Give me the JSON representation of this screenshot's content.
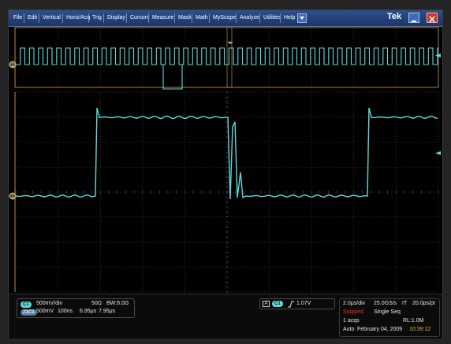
{
  "menu": {
    "items": [
      "File",
      "Edit",
      "Vertical",
      "Horiz/Acq",
      "Trig",
      "Display",
      "Cursors",
      "Measure",
      "Mask",
      "Math",
      "MyScope",
      "Analyze",
      "Utilities",
      "Help"
    ],
    "brand": "Tek"
  },
  "markers": {
    "ch1_zoom": "1",
    "ch1_main": "1"
  },
  "channel_panel": {
    "ch1_badge": "C1",
    "ch1_scale": "500mV/div",
    "ch1_impedance": "50Ω",
    "ch1_bandwidth": "BW:8.0G",
    "zoom_badge": "Z1C1",
    "zoom_scale": "500mV",
    "zoom_time": "100ns",
    "zoom_pos1": "6.95μs",
    "zoom_pos2": "7.95μs"
  },
  "trigger_panel": {
    "mode_label": "A",
    "source_badge": "C1",
    "slope_icon": "rising-edge",
    "level": "1.07V"
  },
  "timebase_panel": {
    "horizontal_scale": "2.0μs/div",
    "sample_rate": "25.0GS/s",
    "it_label": "IT",
    "resolution": "20.0ps/pt",
    "run_state": "Stopped",
    "acq_mode": "Single Seq",
    "acq_count": "1 acqs",
    "record_length": "RL:1.0M",
    "trigger_mode": "Auto",
    "date": "February 04, 2009",
    "time": "10:39:12"
  },
  "colors": {
    "trace": "#5fd8da",
    "grid": "#5a5a5a",
    "marker": "#d7a64a",
    "stopped": "#ff2a2a",
    "time": "#d9b24a"
  }
}
